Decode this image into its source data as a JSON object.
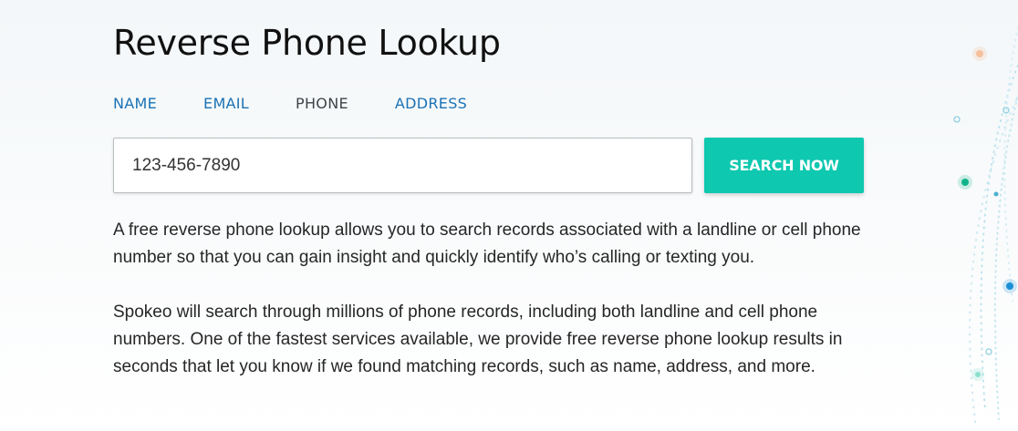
{
  "page": {
    "title": "Reverse Phone Lookup"
  },
  "tabs": [
    {
      "label": "NAME",
      "active": false
    },
    {
      "label": "EMAIL",
      "active": false
    },
    {
      "label": "PHONE",
      "active": true
    },
    {
      "label": "ADDRESS",
      "active": false
    }
  ],
  "search": {
    "value": "123-456-7890",
    "button_label": "SEARCH NOW"
  },
  "description": {
    "paragraph1": "A free reverse phone lookup allows you to search records associated with a landline or cell phone number so that you can gain insight and quickly identify who’s calling or texting you.",
    "paragraph2": "Spokeo will search through millions of phone records, including both landline and cell phone numbers. One of the fastest services available, we provide free reverse phone lookup results in seconds that let you know if we found matching records, such as name, address, and more."
  },
  "colors": {
    "accent_teal": "#0ec8b0",
    "link_blue": "#1b72b5",
    "active_tab": "#3f4448",
    "background": "#f3f7f9"
  }
}
